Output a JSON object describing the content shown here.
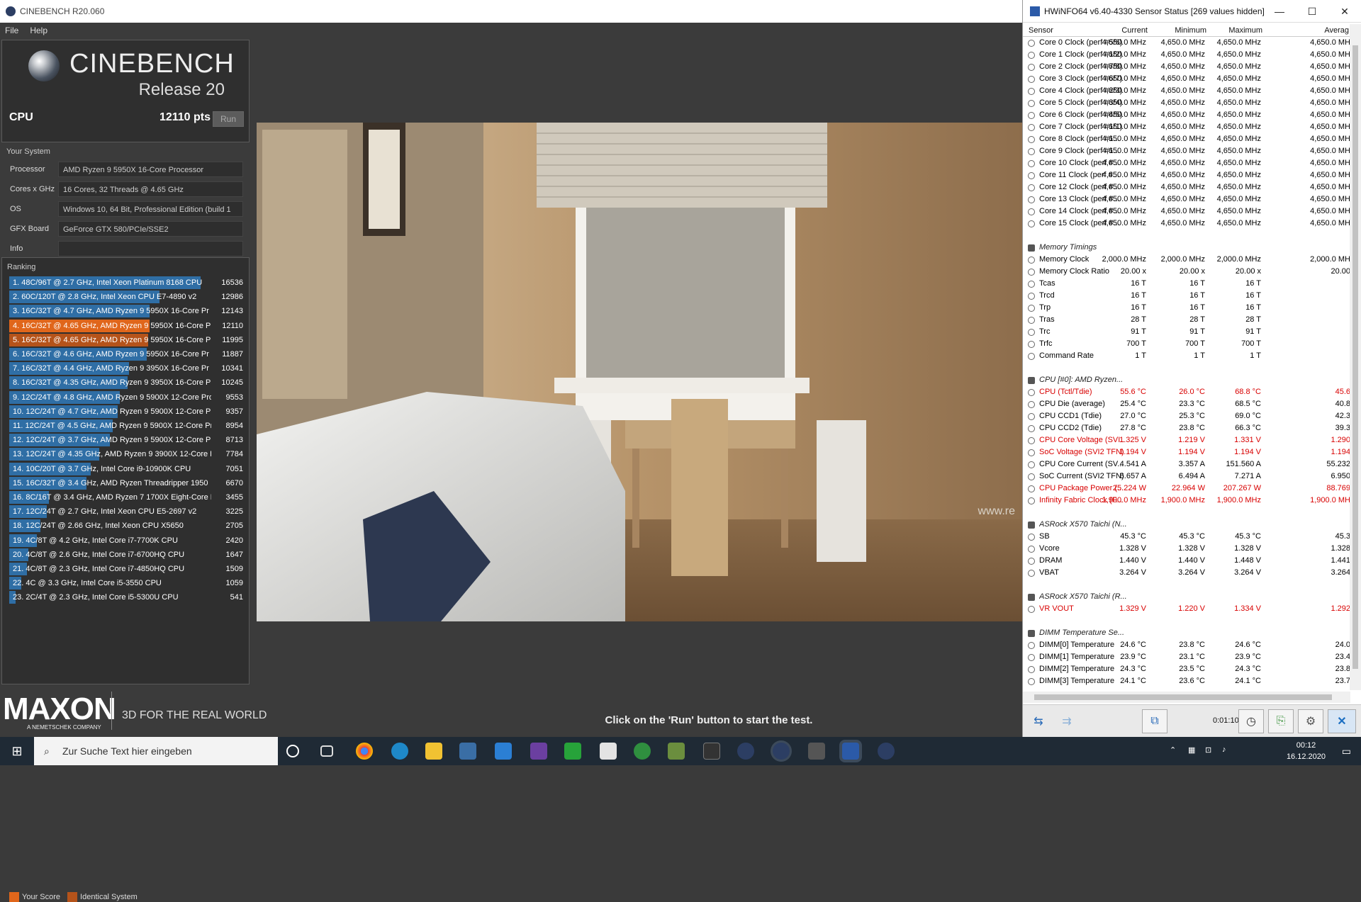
{
  "cinebench": {
    "window_title": "CINEBENCH R20.060",
    "menu": [
      "File",
      "Help"
    ],
    "brand": "CINEBENCH",
    "release": "Release 20",
    "cpu_label": "CPU",
    "cpu_score": "12110 pts",
    "run_label": "Run",
    "your_system_label": "Your System",
    "system": [
      {
        "key": "Processor",
        "value": "AMD Ryzen 9 5950X 16-Core Processor"
      },
      {
        "key": "Cores x GHz",
        "value": "16 Cores, 32 Threads @ 4.65 GHz"
      },
      {
        "key": "OS",
        "value": "Windows 10, 64 Bit, Professional Edition (build 1"
      },
      {
        "key": "GFX Board",
        "value": "GeForce GTX 580/PCIe/SSE2"
      },
      {
        "key": "Info",
        "value": ""
      }
    ],
    "ranking_label": "Ranking",
    "ranking": [
      {
        "label": "1. 48C/96T @ 2.7 GHz, Intel Xeon Platinum 8168 CPU",
        "score": "16536",
        "fill": 1.0,
        "type": "normal"
      },
      {
        "label": "2. 60C/120T @ 2.8 GHz, Intel Xeon CPU E7-4890 v2",
        "score": "12986",
        "fill": 0.785,
        "type": "normal"
      },
      {
        "label": "3. 16C/32T @ 4.7 GHz, AMD Ryzen 9 5950X 16-Core Pr",
        "score": "12143",
        "fill": 0.734,
        "type": "normal"
      },
      {
        "label": "4. 16C/32T @ 4.65 GHz, AMD Ryzen 9 5950X 16-Core P",
        "score": "12110",
        "fill": 0.732,
        "type": "yours"
      },
      {
        "label": "5. 16C/32T @ 4.65 GHz, AMD Ryzen 9 5950X 16-Core P",
        "score": "11995",
        "fill": 0.725,
        "type": "identical"
      },
      {
        "label": "6. 16C/32T @ 4.6 GHz, AMD Ryzen 9 5950X 16-Core Pr",
        "score": "11887",
        "fill": 0.719,
        "type": "normal"
      },
      {
        "label": "7. 16C/32T @ 4.4 GHz, AMD Ryzen 9 3950X 16-Core Pr",
        "score": "10341",
        "fill": 0.625,
        "type": "normal"
      },
      {
        "label": "8. 16C/32T @ 4.35 GHz, AMD Ryzen 9 3950X 16-Core P",
        "score": "10245",
        "fill": 0.62,
        "type": "normal"
      },
      {
        "label": "9. 12C/24T @ 4.8 GHz, AMD Ryzen 9 5900X 12-Core Pro",
        "score": "9553",
        "fill": 0.578,
        "type": "normal"
      },
      {
        "label": "10. 12C/24T @ 4.7 GHz, AMD Ryzen 9 5900X 12-Core Pr",
        "score": "9357",
        "fill": 0.566,
        "type": "normal"
      },
      {
        "label": "11. 12C/24T @ 4.5 GHz, AMD Ryzen 9 5900X 12-Core Pr",
        "score": "8954",
        "fill": 0.541,
        "type": "normal"
      },
      {
        "label": "12. 12C/24T @ 3.7 GHz, AMD Ryzen 9 5900X 12-Core Pr",
        "score": "8713",
        "fill": 0.527,
        "type": "normal"
      },
      {
        "label": "13. 12C/24T @ 4.35 GHz, AMD Ryzen 9 3900X 12-Core P",
        "score": "7784",
        "fill": 0.471,
        "type": "normal"
      },
      {
        "label": "14. 10C/20T @ 3.7 GHz, Intel Core i9-10900K CPU",
        "score": "7051",
        "fill": 0.426,
        "type": "normal"
      },
      {
        "label": "15. 16C/32T @ 3.4 GHz, AMD Ryzen Threadripper 1950",
        "score": "6670",
        "fill": 0.403,
        "type": "normal"
      },
      {
        "label": "16. 8C/16T @ 3.4 GHz, AMD Ryzen 7 1700X Eight-Core F",
        "score": "3455",
        "fill": 0.209,
        "type": "normal"
      },
      {
        "label": "17. 12C/24T @ 2.7 GHz, Intel Xeon CPU E5-2697 v2",
        "score": "3225",
        "fill": 0.195,
        "type": "normal"
      },
      {
        "label": "18. 12C/24T @ 2.66 GHz, Intel Xeon CPU X5650",
        "score": "2705",
        "fill": 0.164,
        "type": "normal"
      },
      {
        "label": "19. 4C/8T @ 4.2 GHz, Intel Core i7-7700K CPU",
        "score": "2420",
        "fill": 0.146,
        "type": "normal"
      },
      {
        "label": "20. 4C/8T @ 2.6 GHz, Intel Core i7-6700HQ CPU",
        "score": "1647",
        "fill": 0.1,
        "type": "normal"
      },
      {
        "label": "21. 4C/8T @ 2.3 GHz, Intel Core i7-4850HQ CPU",
        "score": "1509",
        "fill": 0.091,
        "type": "normal"
      },
      {
        "label": "22. 4C @ 3.3 GHz, Intel Core i5-3550 CPU",
        "score": "1059",
        "fill": 0.064,
        "type": "normal"
      },
      {
        "label": "23. 2C/4T @ 2.3 GHz, Intel Core i5-5300U CPU",
        "score": "541",
        "fill": 0.033,
        "type": "normal"
      }
    ],
    "legend_yours": "Your Score",
    "legend_identical": "Identical System",
    "maxon": "MAXON",
    "maxon_sub": "A NEMETSCHEK COMPANY",
    "tagline": "3D FOR THE REAL WORLD",
    "render_watermark": "www.re",
    "hint": "Click on the 'Run' button to start the test."
  },
  "colors": {
    "bar": "#2f6ea5",
    "yours": "#e0661b",
    "identical": "#b5531a",
    "red": "#d80000"
  },
  "hwinfo": {
    "title": "HWiNFO64 v6.40-4330 Sensor Status [269 values hidden]",
    "columns": [
      "Sensor",
      "Current",
      "Minimum",
      "Maximum",
      "Averag"
    ],
    "rows": [
      {
        "n": "Core 0 Clock (perf #5/6)",
        "v": [
          "4,650.0 MHz",
          "4,650.0 MHz",
          "4,650.0 MHz",
          "4,650.0 MH"
        ]
      },
      {
        "n": "Core 1 Clock (perf #1/2)",
        "v": [
          "4,650.0 MHz",
          "4,650.0 MHz",
          "4,650.0 MHz",
          "4,650.0 MH"
        ]
      },
      {
        "n": "Core 2 Clock (perf #7/8)",
        "v": [
          "4,650.0 MHz",
          "4,650.0 MHz",
          "4,650.0 MHz",
          "4,650.0 MH"
        ]
      },
      {
        "n": "Core 3 Clock (perf #6/7)",
        "v": [
          "4,650.0 MHz",
          "4,650.0 MHz",
          "4,650.0 MHz",
          "4,650.0 MH"
        ]
      },
      {
        "n": "Core 4 Clock (perf #2/3)",
        "v": [
          "4,650.0 MHz",
          "4,650.0 MHz",
          "4,650.0 MHz",
          "4,650.0 MH"
        ]
      },
      {
        "n": "Core 5 Clock (perf #3/4)",
        "v": [
          "4,650.0 MHz",
          "4,650.0 MHz",
          "4,650.0 MHz",
          "4,650.0 MH"
        ]
      },
      {
        "n": "Core 6 Clock (perf #4/5)",
        "v": [
          "4,650.0 MHz",
          "4,650.0 MHz",
          "4,650.0 MHz",
          "4,650.0 MH"
        ]
      },
      {
        "n": "Core 7 Clock (perf #1/1)",
        "v": [
          "4,650.0 MHz",
          "4,650.0 MHz",
          "4,650.0 MHz",
          "4,650.0 MH"
        ]
      },
      {
        "n": "Core 8 Clock (perf #1...",
        "v": [
          "4,650.0 MHz",
          "4,650.0 MHz",
          "4,650.0 MHz",
          "4,650.0 MH"
        ]
      },
      {
        "n": "Core 9 Clock (perf #1...",
        "v": [
          "4,650.0 MHz",
          "4,650.0 MHz",
          "4,650.0 MHz",
          "4,650.0 MH"
        ]
      },
      {
        "n": "Core 10 Clock (perf #...",
        "v": [
          "4,650.0 MHz",
          "4,650.0 MHz",
          "4,650.0 MHz",
          "4,650.0 MH"
        ]
      },
      {
        "n": "Core 11 Clock (perf #...",
        "v": [
          "4,650.0 MHz",
          "4,650.0 MHz",
          "4,650.0 MHz",
          "4,650.0 MH"
        ]
      },
      {
        "n": "Core 12 Clock (perf #...",
        "v": [
          "4,650.0 MHz",
          "4,650.0 MHz",
          "4,650.0 MHz",
          "4,650.0 MH"
        ]
      },
      {
        "n": "Core 13 Clock (perf #...",
        "v": [
          "4,650.0 MHz",
          "4,650.0 MHz",
          "4,650.0 MHz",
          "4,650.0 MH"
        ]
      },
      {
        "n": "Core 14 Clock (perf #...",
        "v": [
          "4,650.0 MHz",
          "4,650.0 MHz",
          "4,650.0 MHz",
          "4,650.0 MH"
        ]
      },
      {
        "n": "Core 15 Clock (perf #...",
        "v": [
          "4,650.0 MHz",
          "4,650.0 MHz",
          "4,650.0 MHz",
          "4,650.0 MH"
        ]
      },
      {
        "n": "",
        "v": [
          "",
          "",
          "",
          ""
        ],
        "blank": true
      },
      {
        "n": "Memory Timings",
        "v": [
          "",
          "",
          "",
          ""
        ],
        "group": true
      },
      {
        "n": "Memory Clock",
        "v": [
          "2,000.0 MHz",
          "2,000.0 MHz",
          "2,000.0 MHz",
          "2,000.0 MH"
        ]
      },
      {
        "n": "Memory Clock Ratio",
        "v": [
          "20.00 x",
          "20.00 x",
          "20.00 x",
          "20.00"
        ]
      },
      {
        "n": "Tcas",
        "v": [
          "16 T",
          "16 T",
          "16 T",
          ""
        ]
      },
      {
        "n": "Trcd",
        "v": [
          "16 T",
          "16 T",
          "16 T",
          ""
        ]
      },
      {
        "n": "Trp",
        "v": [
          "16 T",
          "16 T",
          "16 T",
          ""
        ]
      },
      {
        "n": "Tras",
        "v": [
          "28 T",
          "28 T",
          "28 T",
          ""
        ]
      },
      {
        "n": "Trc",
        "v": [
          "91 T",
          "91 T",
          "91 T",
          ""
        ]
      },
      {
        "n": "Trfc",
        "v": [
          "700 T",
          "700 T",
          "700 T",
          ""
        ]
      },
      {
        "n": "Command Rate",
        "v": [
          "1 T",
          "1 T",
          "1 T",
          ""
        ]
      },
      {
        "n": "",
        "v": [
          "",
          "",
          "",
          ""
        ],
        "blank": true
      },
      {
        "n": "CPU [#0]: AMD Ryzen...",
        "v": [
          "",
          "",
          "",
          ""
        ],
        "group": true
      },
      {
        "n": "CPU (Tctl/Tdie)",
        "v": [
          "55.6 °C",
          "26.0 °C",
          "68.8 °C",
          "45.6"
        ],
        "red": true
      },
      {
        "n": "CPU Die (average)",
        "v": [
          "25.4 °C",
          "23.3 °C",
          "68.5 °C",
          "40.8"
        ]
      },
      {
        "n": "CPU CCD1 (Tdie)",
        "v": [
          "27.0 °C",
          "25.3 °C",
          "69.0 °C",
          "42.3"
        ]
      },
      {
        "n": "CPU CCD2 (Tdie)",
        "v": [
          "27.8 °C",
          "23.8 °C",
          "66.3 °C",
          "39.3"
        ]
      },
      {
        "n": "CPU Core Voltage (SVI...",
        "v": [
          "1.325 V",
          "1.219 V",
          "1.331 V",
          "1.290"
        ],
        "red": true
      },
      {
        "n": "SoC Voltage (SVI2 TFN)",
        "v": [
          "1.194 V",
          "1.194 V",
          "1.194 V",
          "1.194"
        ],
        "red": true
      },
      {
        "n": "CPU Core Current (SV...",
        "v": [
          "4.541 A",
          "3.357 A",
          "151.560 A",
          "55.232"
        ]
      },
      {
        "n": "SoC Current (SVI2 TFN)",
        "v": [
          "6.657 A",
          "6.494 A",
          "7.271 A",
          "6.950"
        ]
      },
      {
        "n": "CPU Package Power (...",
        "v": [
          "25.224 W",
          "22.964 W",
          "207.267 W",
          "88.769"
        ],
        "red": true
      },
      {
        "n": "Infinity Fabric Clock (F...",
        "v": [
          "1,900.0 MHz",
          "1,900.0 MHz",
          "1,900.0 MHz",
          "1,900.0 MH"
        ],
        "red": true
      },
      {
        "n": "",
        "v": [
          "",
          "",
          "",
          ""
        ],
        "blank": true
      },
      {
        "n": "ASRock X570 Taichi (N...",
        "v": [
          "",
          "",
          "",
          ""
        ],
        "group": true
      },
      {
        "n": "SB",
        "v": [
          "45.3 °C",
          "45.3 °C",
          "45.3 °C",
          "45.3"
        ]
      },
      {
        "n": "Vcore",
        "v": [
          "1.328 V",
          "1.328 V",
          "1.328 V",
          "1.328"
        ]
      },
      {
        "n": "DRAM",
        "v": [
          "1.440 V",
          "1.440 V",
          "1.448 V",
          "1.441"
        ]
      },
      {
        "n": "VBAT",
        "v": [
          "3.264 V",
          "3.264 V",
          "3.264 V",
          "3.264"
        ]
      },
      {
        "n": "",
        "v": [
          "",
          "",
          "",
          ""
        ],
        "blank": true
      },
      {
        "n": "ASRock X570 Taichi (R...",
        "v": [
          "",
          "",
          "",
          ""
        ],
        "group": true
      },
      {
        "n": "VR VOUT",
        "v": [
          "1.329 V",
          "1.220 V",
          "1.334 V",
          "1.292"
        ],
        "red": true
      },
      {
        "n": "",
        "v": [
          "",
          "",
          "",
          ""
        ],
        "blank": true
      },
      {
        "n": "DIMM Temperature Se...",
        "v": [
          "",
          "",
          "",
          ""
        ],
        "group": true
      },
      {
        "n": "DIMM[0] Temperature",
        "v": [
          "24.6 °C",
          "23.8 °C",
          "24.6 °C",
          "24.0"
        ]
      },
      {
        "n": "DIMM[1] Temperature",
        "v": [
          "23.9 °C",
          "23.1 °C",
          "23.9 °C",
          "23.4"
        ]
      },
      {
        "n": "DIMM[2] Temperature",
        "v": [
          "24.3 °C",
          "23.5 °C",
          "24.3 °C",
          "23.8"
        ]
      },
      {
        "n": "DIMM[3] Temperature",
        "v": [
          "24.1 °C",
          "23.6 °C",
          "24.1 °C",
          "23.7"
        ]
      }
    ],
    "timer": "0:01:10"
  },
  "taskbar": {
    "search_placeholder": "Zur Suche Text hier eingeben",
    "time": "00:12",
    "date": "16.12.2020"
  }
}
